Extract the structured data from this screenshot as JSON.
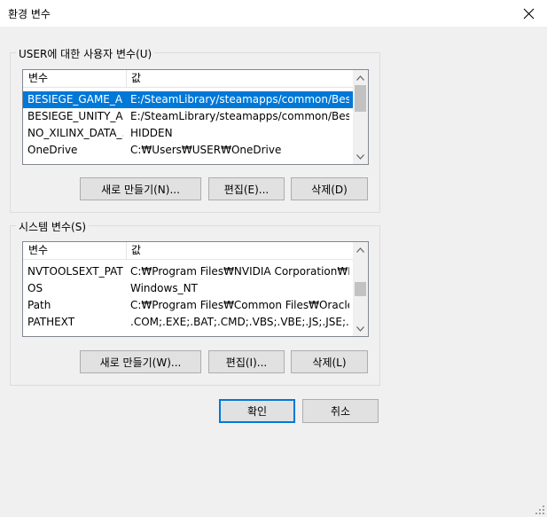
{
  "window": {
    "title": "환경 변수"
  },
  "user_vars": {
    "legend": "USER에 대한 사용자 변수(U)",
    "columns": {
      "name": "변수",
      "value": "값"
    },
    "rows": [
      {
        "name": "BESIEGE_GAME_A...",
        "value": "E:/SteamLibrary/steamapps/common/Besie...",
        "selected": true
      },
      {
        "name": "BESIEGE_UNITY_A...",
        "value": "E:/SteamLibrary/steamapps/common/Besie..."
      },
      {
        "name": "NO_XILINX_DATA_...",
        "value": "HIDDEN"
      },
      {
        "name": "OneDrive",
        "value": "C:₩Users₩USER₩OneDrive"
      }
    ],
    "buttons": {
      "new": "새로 만들기(N)...",
      "edit": "편집(E)...",
      "delete": "삭제(D)"
    }
  },
  "system_vars": {
    "legend": "시스템 변수(S)",
    "columns": {
      "name": "변수",
      "value": "값"
    },
    "rows": [
      {
        "name": "NVTOOLSEXT_PATH",
        "value": "C:₩Program Files₩NVIDIA Corporation₩Nv..."
      },
      {
        "name": "OS",
        "value": "Windows_NT"
      },
      {
        "name": "Path",
        "value": "C:₩Program Files₩Common Files₩Oracle₩..."
      },
      {
        "name": "PATHEXT",
        "value": ".COM;.EXE;.BAT;.CMD;.VBS;.VBE;.JS;.JSE;.W..."
      }
    ],
    "buttons": {
      "new": "새로 만들기(W)...",
      "edit": "편집(I)...",
      "delete": "삭제(L)"
    }
  },
  "dialog_buttons": {
    "ok": "확인",
    "cancel": "취소"
  },
  "colors": {
    "selection": "#0078d7",
    "default_button_border": "#0078d7"
  },
  "icons": {
    "close": "close-icon",
    "scroll_up": "chevron-up-icon",
    "scroll_down": "chevron-down-icon",
    "resize": "resize-grip-icon"
  }
}
